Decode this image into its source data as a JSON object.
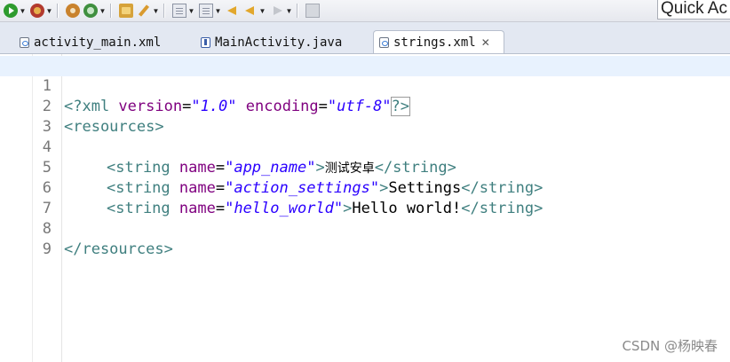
{
  "toolbar": {
    "icons": [
      "run-icon",
      "debug-icon",
      "android-icon",
      "refresh-icon",
      "open-folder-icon",
      "brush-icon",
      "document-icon",
      "annotation-icon",
      "back-icon",
      "forward-icon",
      "pin-icon"
    ],
    "quick_access_value": "Quick Ac"
  },
  "tabs": [
    {
      "label": "activity_main.xml",
      "icon": "xml-file-icon",
      "active": false
    },
    {
      "label": "MainActivity.java",
      "icon": "java-file-icon",
      "active": false
    },
    {
      "label": "strings.xml",
      "icon": "xml-file-icon",
      "active": true,
      "close": "✕"
    }
  ],
  "editor": {
    "line_numbers": [
      "1",
      "2",
      "3",
      "4",
      "5",
      "6",
      "7",
      "8",
      "9"
    ],
    "l1": {
      "open": "<?xml ",
      "a1": "version",
      "eq1": "=",
      "v1": "\"1.0\"",
      "a2": " encoding",
      "eq2": "=",
      "v2": "\"utf-8\"",
      "close": "?>"
    },
    "l2": {
      "tag": "<resources>"
    },
    "l4": {
      "open": "<string ",
      "attr": "name",
      "eq": "=",
      "val": "\"app_name\"",
      "gt": ">",
      "text": "测试安卓",
      "close": "</string>"
    },
    "l5": {
      "open": "<string ",
      "attr": "name",
      "eq": "=",
      "val": "\"action_settings\"",
      "gt": ">",
      "text": "Settings",
      "close": "</string>"
    },
    "l6": {
      "open": "<string ",
      "attr": "name",
      "eq": "=",
      "val": "\"hello_world\"",
      "gt": ">",
      "text": "Hello world!",
      "close": "</string>"
    },
    "l8": {
      "tag": "</resources>"
    }
  },
  "watermark": "CSDN @杨映春",
  "colors": {
    "tag": "#3f7f7f",
    "attribute": "#7f007f",
    "string": "#2a00ff",
    "current_line": "#e8f2fe"
  }
}
